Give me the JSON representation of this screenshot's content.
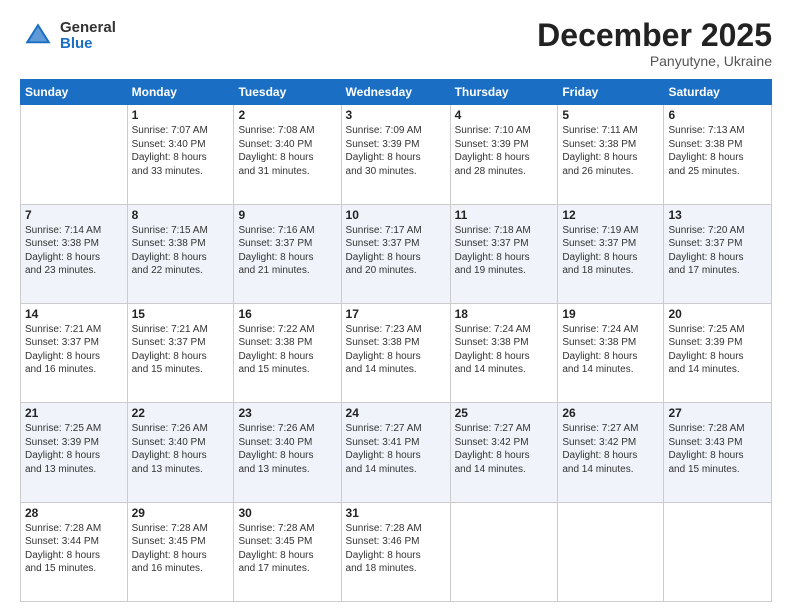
{
  "header": {
    "logo_general": "General",
    "logo_blue": "Blue",
    "month_title": "December 2025",
    "subtitle": "Panyutyne, Ukraine"
  },
  "weekdays": [
    "Sunday",
    "Monday",
    "Tuesday",
    "Wednesday",
    "Thursday",
    "Friday",
    "Saturday"
  ],
  "weeks": [
    [
      {
        "day": "",
        "info": ""
      },
      {
        "day": "1",
        "info": "Sunrise: 7:07 AM\nSunset: 3:40 PM\nDaylight: 8 hours\nand 33 minutes."
      },
      {
        "day": "2",
        "info": "Sunrise: 7:08 AM\nSunset: 3:40 PM\nDaylight: 8 hours\nand 31 minutes."
      },
      {
        "day": "3",
        "info": "Sunrise: 7:09 AM\nSunset: 3:39 PM\nDaylight: 8 hours\nand 30 minutes."
      },
      {
        "day": "4",
        "info": "Sunrise: 7:10 AM\nSunset: 3:39 PM\nDaylight: 8 hours\nand 28 minutes."
      },
      {
        "day": "5",
        "info": "Sunrise: 7:11 AM\nSunset: 3:38 PM\nDaylight: 8 hours\nand 26 minutes."
      },
      {
        "day": "6",
        "info": "Sunrise: 7:13 AM\nSunset: 3:38 PM\nDaylight: 8 hours\nand 25 minutes."
      }
    ],
    [
      {
        "day": "7",
        "info": "Sunrise: 7:14 AM\nSunset: 3:38 PM\nDaylight: 8 hours\nand 23 minutes."
      },
      {
        "day": "8",
        "info": "Sunrise: 7:15 AM\nSunset: 3:38 PM\nDaylight: 8 hours\nand 22 minutes."
      },
      {
        "day": "9",
        "info": "Sunrise: 7:16 AM\nSunset: 3:37 PM\nDaylight: 8 hours\nand 21 minutes."
      },
      {
        "day": "10",
        "info": "Sunrise: 7:17 AM\nSunset: 3:37 PM\nDaylight: 8 hours\nand 20 minutes."
      },
      {
        "day": "11",
        "info": "Sunrise: 7:18 AM\nSunset: 3:37 PM\nDaylight: 8 hours\nand 19 minutes."
      },
      {
        "day": "12",
        "info": "Sunrise: 7:19 AM\nSunset: 3:37 PM\nDaylight: 8 hours\nand 18 minutes."
      },
      {
        "day": "13",
        "info": "Sunrise: 7:20 AM\nSunset: 3:37 PM\nDaylight: 8 hours\nand 17 minutes."
      }
    ],
    [
      {
        "day": "14",
        "info": "Sunrise: 7:21 AM\nSunset: 3:37 PM\nDaylight: 8 hours\nand 16 minutes."
      },
      {
        "day": "15",
        "info": "Sunrise: 7:21 AM\nSunset: 3:37 PM\nDaylight: 8 hours\nand 15 minutes."
      },
      {
        "day": "16",
        "info": "Sunrise: 7:22 AM\nSunset: 3:38 PM\nDaylight: 8 hours\nand 15 minutes."
      },
      {
        "day": "17",
        "info": "Sunrise: 7:23 AM\nSunset: 3:38 PM\nDaylight: 8 hours\nand 14 minutes."
      },
      {
        "day": "18",
        "info": "Sunrise: 7:24 AM\nSunset: 3:38 PM\nDaylight: 8 hours\nand 14 minutes."
      },
      {
        "day": "19",
        "info": "Sunrise: 7:24 AM\nSunset: 3:38 PM\nDaylight: 8 hours\nand 14 minutes."
      },
      {
        "day": "20",
        "info": "Sunrise: 7:25 AM\nSunset: 3:39 PM\nDaylight: 8 hours\nand 14 minutes."
      }
    ],
    [
      {
        "day": "21",
        "info": "Sunrise: 7:25 AM\nSunset: 3:39 PM\nDaylight: 8 hours\nand 13 minutes."
      },
      {
        "day": "22",
        "info": "Sunrise: 7:26 AM\nSunset: 3:40 PM\nDaylight: 8 hours\nand 13 minutes."
      },
      {
        "day": "23",
        "info": "Sunrise: 7:26 AM\nSunset: 3:40 PM\nDaylight: 8 hours\nand 13 minutes."
      },
      {
        "day": "24",
        "info": "Sunrise: 7:27 AM\nSunset: 3:41 PM\nDaylight: 8 hours\nand 14 minutes."
      },
      {
        "day": "25",
        "info": "Sunrise: 7:27 AM\nSunset: 3:42 PM\nDaylight: 8 hours\nand 14 minutes."
      },
      {
        "day": "26",
        "info": "Sunrise: 7:27 AM\nSunset: 3:42 PM\nDaylight: 8 hours\nand 14 minutes."
      },
      {
        "day": "27",
        "info": "Sunrise: 7:28 AM\nSunset: 3:43 PM\nDaylight: 8 hours\nand 15 minutes."
      }
    ],
    [
      {
        "day": "28",
        "info": "Sunrise: 7:28 AM\nSunset: 3:44 PM\nDaylight: 8 hours\nand 15 minutes."
      },
      {
        "day": "29",
        "info": "Sunrise: 7:28 AM\nSunset: 3:45 PM\nDaylight: 8 hours\nand 16 minutes."
      },
      {
        "day": "30",
        "info": "Sunrise: 7:28 AM\nSunset: 3:45 PM\nDaylight: 8 hours\nand 17 minutes."
      },
      {
        "day": "31",
        "info": "Sunrise: 7:28 AM\nSunset: 3:46 PM\nDaylight: 8 hours\nand 18 minutes."
      },
      {
        "day": "",
        "info": ""
      },
      {
        "day": "",
        "info": ""
      },
      {
        "day": "",
        "info": ""
      }
    ]
  ]
}
